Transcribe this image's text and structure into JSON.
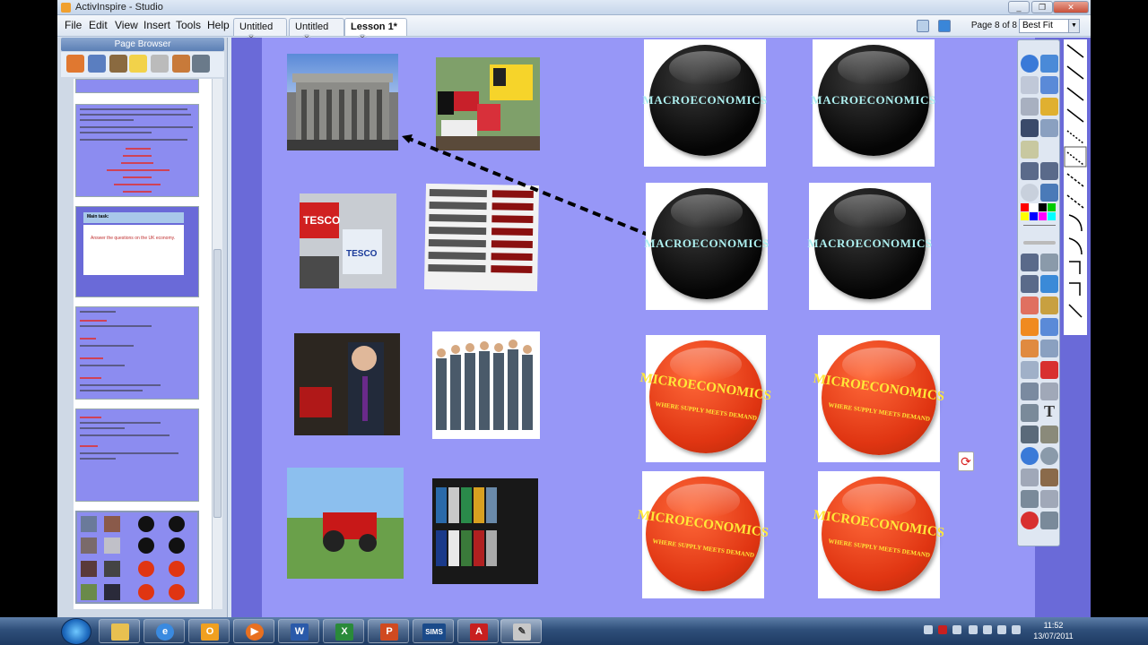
{
  "window": {
    "title": "ActivInspire - Studio"
  },
  "menu": [
    "File",
    "Edit",
    "View",
    "Insert",
    "Tools",
    "Help"
  ],
  "tabs": [
    {
      "label": "Untitled"
    },
    {
      "label": "Untitled"
    },
    {
      "label": "Lesson 1*"
    }
  ],
  "toolbar": {
    "page_info": "Page 8 of 8",
    "zoom": "Best Fit"
  },
  "page_browser": {
    "title": "Page Browser"
  },
  "thumbnails": {
    "task_heading": "Main task:",
    "task_text": "Answer the questions on the UK economy."
  },
  "canvas": {
    "macro_label": "MACROECONOMICS",
    "micro_label": "MICROECONOMICS",
    "micro_sub": "WHERE SUPPLY MEETS DEMAND"
  },
  "taskbar": {
    "time": "11:52",
    "date": "13/07/2011",
    "sims": "SIMS"
  },
  "colors": {
    "canvas_bg": "#9797f7",
    "canvas_margin": "#6a6ad8",
    "macro_disc": "#0a0a0a",
    "micro_disc": "#e03512"
  }
}
